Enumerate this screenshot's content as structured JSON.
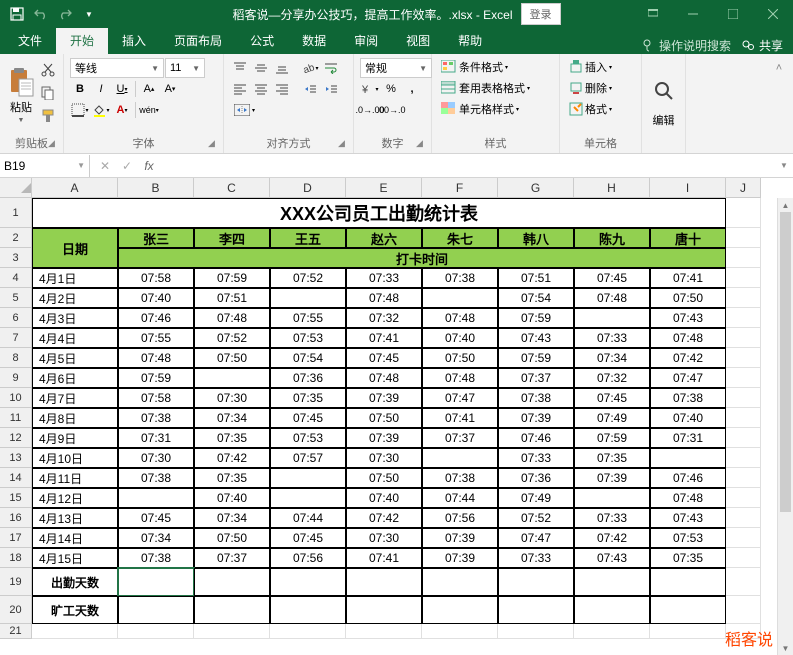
{
  "titlebar": {
    "filename": "稻客说—分享办公技巧，提高工作效率。.xlsx - Excel",
    "login": "登录"
  },
  "tabs": {
    "file": "文件",
    "home": "开始",
    "insert": "插入",
    "layout": "页面布局",
    "formulas": "公式",
    "data": "数据",
    "review": "审阅",
    "view": "视图",
    "help": "帮助",
    "tellme": "操作说明搜索",
    "share": "共享"
  },
  "ribbon": {
    "clipboard": {
      "paste": "粘贴",
      "label": "剪贴板"
    },
    "font": {
      "name": "等线",
      "size": "11",
      "label": "字体",
      "wen": "wén"
    },
    "align": {
      "label": "对齐方式"
    },
    "number": {
      "format": "常规",
      "label": "数字"
    },
    "styles": {
      "cond": "条件格式",
      "table": "套用表格格式",
      "cell": "单元格样式",
      "label": "样式"
    },
    "cells": {
      "insert": "插入",
      "delete": "删除",
      "format": "格式",
      "label": "单元格"
    },
    "editing": {
      "label": "编辑"
    }
  },
  "fx": {
    "namebox": "B19",
    "fxlabel": "fx"
  },
  "cols": [
    "A",
    "B",
    "C",
    "D",
    "E",
    "F",
    "G",
    "H",
    "I",
    "J"
  ],
  "rows": [
    "1",
    "2",
    "3",
    "4",
    "5",
    "6",
    "7",
    "8",
    "9",
    "10",
    "11",
    "12",
    "13",
    "14",
    "15",
    "16",
    "17",
    "18",
    "19",
    "20",
    "21"
  ],
  "sheet": {
    "title": "XXX公司员工出勤统计表",
    "date_hdr": "日期",
    "names": [
      "张三",
      "李四",
      "王五",
      "赵六",
      "朱七",
      "韩八",
      "陈九",
      "唐十"
    ],
    "clock_hdr": "打卡时间",
    "attend": "出勤天数",
    "absent": "旷工天数",
    "data": [
      {
        "d": "4月1日",
        "v": [
          "07:58",
          "07:59",
          "07:52",
          "07:33",
          "07:38",
          "07:51",
          "07:45",
          "07:41"
        ]
      },
      {
        "d": "4月2日",
        "v": [
          "07:40",
          "07:51",
          "",
          "07:48",
          "",
          "07:54",
          "07:48",
          "07:50"
        ]
      },
      {
        "d": "4月3日",
        "v": [
          "07:46",
          "07:48",
          "07:55",
          "07:32",
          "07:48",
          "07:59",
          "",
          "07:43"
        ]
      },
      {
        "d": "4月4日",
        "v": [
          "07:55",
          "07:52",
          "07:53",
          "07:41",
          "07:40",
          "07:43",
          "07:33",
          "07:48"
        ]
      },
      {
        "d": "4月5日",
        "v": [
          "07:48",
          "07:50",
          "07:54",
          "07:45",
          "07:50",
          "07:59",
          "07:34",
          "07:42"
        ]
      },
      {
        "d": "4月6日",
        "v": [
          "07:59",
          "",
          "07:36",
          "07:48",
          "07:48",
          "07:37",
          "07:32",
          "07:47"
        ]
      },
      {
        "d": "4月7日",
        "v": [
          "07:58",
          "07:30",
          "07:35",
          "07:39",
          "07:47",
          "07:38",
          "07:45",
          "07:38"
        ]
      },
      {
        "d": "4月8日",
        "v": [
          "07:38",
          "07:34",
          "07:45",
          "07:50",
          "07:41",
          "07:39",
          "07:49",
          "07:40"
        ]
      },
      {
        "d": "4月9日",
        "v": [
          "07:31",
          "07:35",
          "07:53",
          "07:39",
          "07:37",
          "07:46",
          "07:59",
          "07:31"
        ]
      },
      {
        "d": "4月10日",
        "v": [
          "07:30",
          "07:42",
          "07:57",
          "07:30",
          "",
          "07:33",
          "07:35",
          ""
        ]
      },
      {
        "d": "4月11日",
        "v": [
          "07:38",
          "07:35",
          "",
          "07:50",
          "07:38",
          "07:36",
          "07:39",
          "07:46"
        ]
      },
      {
        "d": "4月12日",
        "v": [
          "",
          "07:40",
          "",
          "07:40",
          "07:44",
          "07:49",
          "",
          "07:48"
        ]
      },
      {
        "d": "4月13日",
        "v": [
          "07:45",
          "07:34",
          "07:44",
          "07:42",
          "07:56",
          "07:52",
          "07:33",
          "07:43"
        ]
      },
      {
        "d": "4月14日",
        "v": [
          "07:34",
          "07:50",
          "07:45",
          "07:30",
          "07:39",
          "07:47",
          "07:42",
          "07:53"
        ]
      },
      {
        "d": "4月15日",
        "v": [
          "07:38",
          "07:37",
          "07:56",
          "07:41",
          "07:39",
          "07:33",
          "07:43",
          "07:35"
        ]
      }
    ]
  },
  "watermark": "稻客说"
}
